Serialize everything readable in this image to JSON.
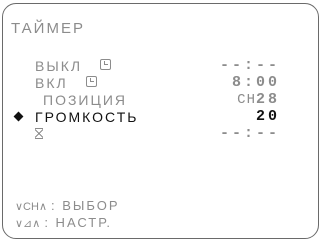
{
  "screen": {
    "title": "ТАЙМЕР",
    "rows": [
      {
        "label": "ВЫКЛ",
        "value": "--:--",
        "icon": "clock-icon"
      },
      {
        "label": "ВКЛ",
        "value": "8:00",
        "icon": "clock-icon"
      },
      {
        "label": "ПОЗИЦИЯ",
        "value_prefix": "СН",
        "value": "28"
      },
      {
        "label": "ГРОМКОСТЬ",
        "value": "20",
        "selected": true
      },
      {
        "label": "",
        "value": "--:--",
        "icon": "hourglass-icon"
      }
    ],
    "hints": [
      {
        "keys": "∨CH∧",
        "action": ": ВЫБОР"
      },
      {
        "keys": "∨⊿∧",
        "action": ": НАСТР."
      }
    ]
  },
  "colors": {
    "text_dim": "#8c8c8c",
    "text_active": "#111111",
    "border": "#6a6a6a"
  }
}
